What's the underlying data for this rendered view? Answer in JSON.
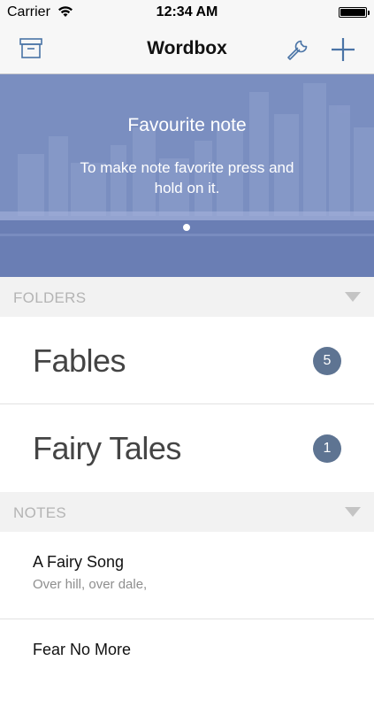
{
  "status_bar": {
    "carrier": "Carrier",
    "time": "12:34 AM"
  },
  "nav": {
    "title": "Wordbox",
    "left_icon": "archive-box-icon",
    "right_icons": [
      "wrench-icon",
      "plus-icon"
    ]
  },
  "banner": {
    "title": "Favourite note",
    "body": "To make note favorite press and hold on it.",
    "page_count": 1,
    "current_page": 1
  },
  "folders_section": {
    "label": "FOLDERS",
    "items": [
      {
        "name": "Fables",
        "count": "5"
      },
      {
        "name": "Fairy Tales",
        "count": "1"
      }
    ]
  },
  "notes_section": {
    "label": "NOTES",
    "items": [
      {
        "title": "A Fairy Song",
        "preview": "Over hill, over dale,"
      },
      {
        "title": "Fear No More",
        "preview": ""
      }
    ]
  },
  "colors": {
    "accent": "#4a74a6",
    "badge": "#5e7492",
    "section_bg": "#f2f2f2",
    "section_text": "#b4b4b4",
    "banner_tint": "#7489bd"
  }
}
